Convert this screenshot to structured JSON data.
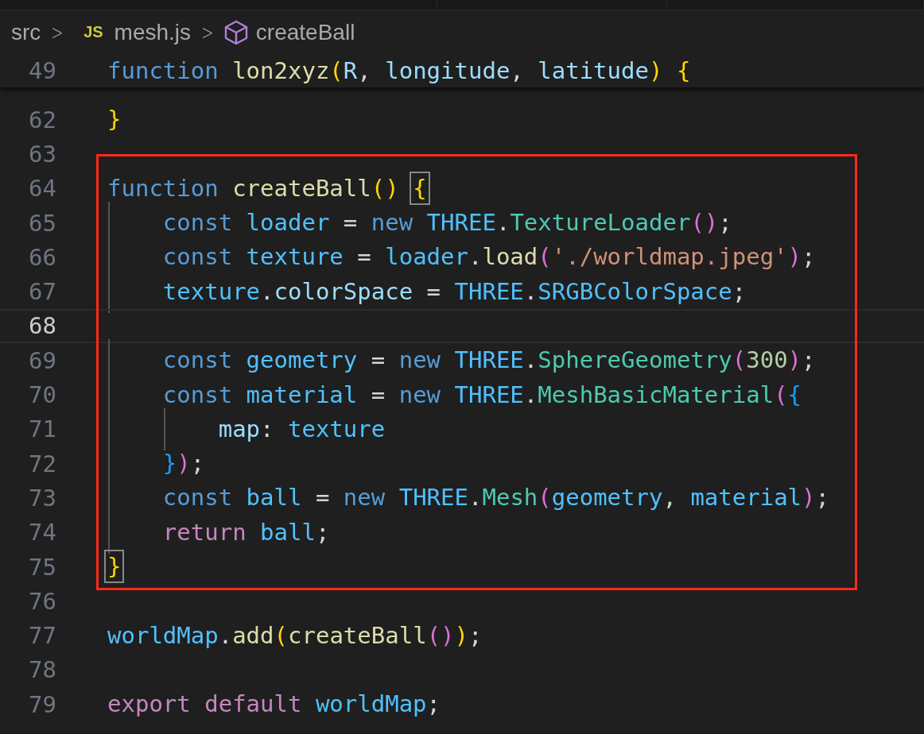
{
  "breadcrumb": {
    "folder": "src",
    "separator": ">",
    "file_icon": "JS",
    "file": "mesh.js",
    "symbol": "createBall"
  },
  "sticky_line": {
    "number": "49",
    "tokens": [
      {
        "text": "function ",
        "kind": "keyword"
      },
      {
        "text": "lon2xyz",
        "kind": "fn"
      },
      {
        "text": "(",
        "kind": "bracket1"
      },
      {
        "text": "R",
        "kind": "var"
      },
      {
        "text": ", ",
        "kind": "plain"
      },
      {
        "text": "longitude",
        "kind": "var"
      },
      {
        "text": ", ",
        "kind": "plain"
      },
      {
        "text": "latitude",
        "kind": "var"
      },
      {
        "text": ") ",
        "kind": "bracket1"
      },
      {
        "text": "{",
        "kind": "bracket1"
      }
    ]
  },
  "blocks": [
    {
      "boxed": false,
      "lines": [
        {
          "number": "62",
          "current": false,
          "tokens": [
            {
              "text": "}",
              "kind": "bracket1"
            }
          ]
        },
        {
          "number": "63",
          "current": false
        }
      ]
    },
    {
      "boxed": true,
      "lines": [
        {
          "number": "64",
          "current": false,
          "tokens": [
            {
              "text": "function ",
              "kind": "keyword"
            },
            {
              "text": "createBall",
              "kind": "fn"
            },
            {
              "text": "() ",
              "kind": "bracket1"
            },
            {
              "text": "{",
              "kind": "bracket1",
              "matched": true
            }
          ]
        },
        {
          "number": "65",
          "current": false,
          "tokens": [
            {
              "text": "    const ",
              "kind": "keyword"
            },
            {
              "text": "loader",
              "kind": "const"
            },
            {
              "text": " = ",
              "kind": "plain"
            },
            {
              "text": "new ",
              "kind": "keyword"
            },
            {
              "text": "THREE",
              "kind": "const"
            },
            {
              "text": ".",
              "kind": "plain"
            },
            {
              "text": "TextureLoader",
              "kind": "class"
            },
            {
              "text": "()",
              "kind": "bracket2"
            },
            {
              "text": ";",
              "kind": "plain"
            }
          ]
        },
        {
          "number": "66",
          "current": false,
          "tokens": [
            {
              "text": "    const ",
              "kind": "keyword"
            },
            {
              "text": "texture",
              "kind": "const"
            },
            {
              "text": " = ",
              "kind": "plain"
            },
            {
              "text": "loader",
              "kind": "const"
            },
            {
              "text": ".",
              "kind": "plain"
            },
            {
              "text": "load",
              "kind": "fn"
            },
            {
              "text": "(",
              "kind": "bracket2"
            },
            {
              "text": "'./worldmap.jpeg'",
              "kind": "string"
            },
            {
              "text": ")",
              "kind": "bracket2"
            },
            {
              "text": ";",
              "kind": "plain"
            }
          ]
        },
        {
          "number": "67",
          "current": false,
          "tokens": [
            {
              "text": "    texture",
              "kind": "const"
            },
            {
              "text": ".",
              "kind": "plain"
            },
            {
              "text": "colorSpace",
              "kind": "var"
            },
            {
              "text": " = ",
              "kind": "plain"
            },
            {
              "text": "THREE",
              "kind": "const"
            },
            {
              "text": ".",
              "kind": "plain"
            },
            {
              "text": "SRGBColorSpace",
              "kind": "const"
            },
            {
              "text": ";",
              "kind": "plain"
            }
          ]
        },
        {
          "number": "68",
          "current": true
        },
        {
          "number": "69",
          "current": false,
          "tokens": [
            {
              "text": "    const ",
              "kind": "keyword"
            },
            {
              "text": "geometry",
              "kind": "const"
            },
            {
              "text": " = ",
              "kind": "plain"
            },
            {
              "text": "new ",
              "kind": "keyword"
            },
            {
              "text": "THREE",
              "kind": "const"
            },
            {
              "text": ".",
              "kind": "plain"
            },
            {
              "text": "SphereGeometry",
              "kind": "class"
            },
            {
              "text": "(",
              "kind": "bracket2"
            },
            {
              "text": "300",
              "kind": "number"
            },
            {
              "text": ")",
              "kind": "bracket2"
            },
            {
              "text": ";",
              "kind": "plain"
            }
          ]
        },
        {
          "number": "70",
          "current": false,
          "tokens": [
            {
              "text": "    const ",
              "kind": "keyword"
            },
            {
              "text": "material",
              "kind": "const"
            },
            {
              "text": " = ",
              "kind": "plain"
            },
            {
              "text": "new ",
              "kind": "keyword"
            },
            {
              "text": "THREE",
              "kind": "const"
            },
            {
              "text": ".",
              "kind": "plain"
            },
            {
              "text": "MeshBasicMaterial",
              "kind": "class"
            },
            {
              "text": "(",
              "kind": "bracket2"
            },
            {
              "text": "{",
              "kind": "bracket3"
            }
          ]
        },
        {
          "number": "71",
          "current": false,
          "tokens": [
            {
              "text": "        map",
              "kind": "var"
            },
            {
              "text": ": ",
              "kind": "plain"
            },
            {
              "text": "texture",
              "kind": "const"
            }
          ]
        },
        {
          "number": "72",
          "current": false,
          "tokens": [
            {
              "text": "    }",
              "kind": "bracket3"
            },
            {
              "text": ")",
              "kind": "bracket2"
            },
            {
              "text": ";",
              "kind": "plain"
            }
          ]
        },
        {
          "number": "73",
          "current": false,
          "tokens": [
            {
              "text": "    const ",
              "kind": "keyword"
            },
            {
              "text": "ball",
              "kind": "const"
            },
            {
              "text": " = ",
              "kind": "plain"
            },
            {
              "text": "new ",
              "kind": "keyword"
            },
            {
              "text": "THREE",
              "kind": "const"
            },
            {
              "text": ".",
              "kind": "plain"
            },
            {
              "text": "Mesh",
              "kind": "class"
            },
            {
              "text": "(",
              "kind": "bracket2"
            },
            {
              "text": "geometry",
              "kind": "const"
            },
            {
              "text": ", ",
              "kind": "plain"
            },
            {
              "text": "material",
              "kind": "const"
            },
            {
              "text": ")",
              "kind": "bracket2"
            },
            {
              "text": ";",
              "kind": "plain"
            }
          ]
        },
        {
          "number": "74",
          "current": false,
          "tokens": [
            {
              "text": "    return ",
              "kind": "control"
            },
            {
              "text": "ball",
              "kind": "const"
            },
            {
              "text": ";",
              "kind": "plain"
            }
          ]
        },
        {
          "number": "75",
          "current": false,
          "tokens": [
            {
              "text": "}",
              "kind": "bracket1",
              "matched": true
            }
          ]
        }
      ]
    },
    {
      "boxed": false,
      "lines": [
        {
          "number": "76",
          "current": false
        },
        {
          "number": "77",
          "current": false,
          "tokens": [
            {
              "text": "worldMap",
              "kind": "const"
            },
            {
              "text": ".",
              "kind": "plain"
            },
            {
              "text": "add",
              "kind": "fn"
            },
            {
              "text": "(",
              "kind": "bracket1"
            },
            {
              "text": "createBall",
              "kind": "fn"
            },
            {
              "text": "()",
              "kind": "bracket2"
            },
            {
              "text": ")",
              "kind": "bracket1"
            },
            {
              "text": ";",
              "kind": "plain"
            }
          ]
        },
        {
          "number": "78",
          "current": false
        },
        {
          "number": "79",
          "current": false,
          "tokens": [
            {
              "text": "export default ",
              "kind": "control"
            },
            {
              "text": "worldMap",
              "kind": "const"
            },
            {
              "text": ";",
              "kind": "plain"
            }
          ]
        }
      ]
    }
  ]
}
